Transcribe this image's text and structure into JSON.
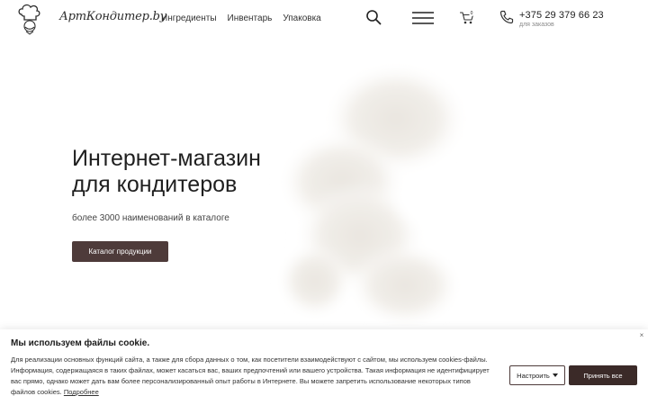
{
  "header": {
    "logo_text": "АртКондитер.by",
    "nav": [
      "Ингредиенты",
      "Инвентарь",
      "Упаковка"
    ],
    "cart_count": "0",
    "phone": "+375 29 379 66 23",
    "phone_note": "для заказов"
  },
  "hero": {
    "title_line1": "Интернет-магазин",
    "title_line2": "для кондитеров",
    "subtitle": "более 3000 наименований в каталоге",
    "cta": "Каталог продукции"
  },
  "cookie": {
    "title": "Мы используем файлы cookie.",
    "body": "Для реализации основных функций сайта, а также для сбора данных о том, как посетители взаимодействуют с сайтом, мы используем cookies-файлы. Информация, содержащаяся в таких файлах, может касаться вас, ваших предпочтений или вашего устройства. Такая информация не идентифицирует вас прямо, однако может дать вам более персонализированный опыт работы в Интернете. Вы можете запретить использование некоторых типов файлов cookies.",
    "more_link": "Подробнее",
    "configure_label": "Настроить",
    "accept_label": "Принять все",
    "close_label": "×"
  },
  "colors": {
    "accent": "#4e3b3a",
    "accept": "#3b2a28"
  },
  "icons": [
    "chef-logo-icon",
    "search-icon",
    "hamburger-menu-icon",
    "cart-icon",
    "phone-icon",
    "caret-down-icon",
    "close-icon"
  ]
}
